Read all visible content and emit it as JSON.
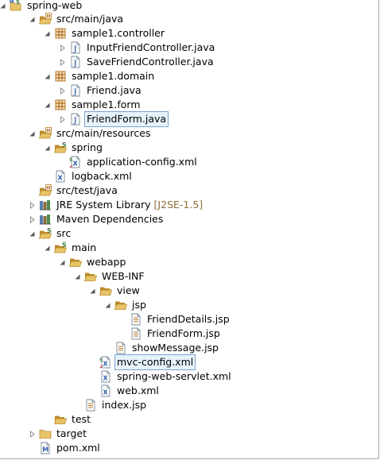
{
  "colors": {
    "folder": "#e8c468",
    "folder_dark": "#b98b2a",
    "package": "#b8792b",
    "java": "#5a7fb5",
    "selection_bg": "#e6f3fb",
    "selection_border": "#7da2ce",
    "decoration": "#8b6e34"
  },
  "tree": [
    {
      "label": "spring-web",
      "icon": "project-icon",
      "twisty": "expanded"
    },
    {
      "label": "src/main/java",
      "icon": "source-folder-icon",
      "twisty": "expanded"
    },
    {
      "label": "sample1.controller",
      "icon": "package-icon",
      "twisty": "expanded"
    },
    {
      "label": "InputFriendController.java",
      "icon": "java-file-icon",
      "twisty": "collapsed"
    },
    {
      "label": "SaveFriendController.java",
      "icon": "java-file-icon",
      "twisty": "collapsed"
    },
    {
      "label": "sample1.domain",
      "icon": "package-icon",
      "twisty": "expanded"
    },
    {
      "label": "Friend.java",
      "icon": "java-file-icon",
      "twisty": "collapsed"
    },
    {
      "label": "sample1.form",
      "icon": "package-icon",
      "twisty": "expanded"
    },
    {
      "label": "FriendForm.java",
      "icon": "java-file-icon",
      "twisty": "collapsed",
      "selected": true
    },
    {
      "label": "src/main/resources",
      "icon": "source-folder-icon",
      "twisty": "expanded"
    },
    {
      "label": "spring",
      "icon": "spring-folder-icon",
      "twisty": "expanded"
    },
    {
      "label": "application-config.xml",
      "icon": "spring-xml-icon",
      "twisty": "none"
    },
    {
      "label": "logback.xml",
      "icon": "xml-file-icon",
      "twisty": "none"
    },
    {
      "label": "src/test/java",
      "icon": "source-folder-icon",
      "twisty": "none"
    },
    {
      "label": "JRE System Library",
      "decoration": "[J2SE-1.5]",
      "icon": "library-icon",
      "twisty": "collapsed"
    },
    {
      "label": "Maven Dependencies",
      "icon": "library-icon",
      "twisty": "collapsed"
    },
    {
      "label": "src",
      "icon": "spring-folder-icon",
      "twisty": "expanded"
    },
    {
      "label": "main",
      "icon": "spring-folder-icon",
      "twisty": "expanded"
    },
    {
      "label": "webapp",
      "icon": "folder-open-icon",
      "twisty": "expanded"
    },
    {
      "label": "WEB-INF",
      "icon": "folder-open-icon",
      "twisty": "expanded"
    },
    {
      "label": "view",
      "icon": "folder-open-icon",
      "twisty": "expanded"
    },
    {
      "label": "jsp",
      "icon": "folder-open-icon",
      "twisty": "expanded"
    },
    {
      "label": "FriendDetails.jsp",
      "icon": "jsp-file-icon",
      "twisty": "none"
    },
    {
      "label": "FriendForm.jsp",
      "icon": "jsp-file-icon",
      "twisty": "none"
    },
    {
      "label": "showMessage.jsp",
      "icon": "jsp-file-icon",
      "twisty": "none"
    },
    {
      "label": "mvc-config.xml",
      "icon": "spring-xml-icon",
      "twisty": "none",
      "selected": true
    },
    {
      "label": "spring-web-servlet.xml",
      "icon": "xml-file-icon",
      "twisty": "none"
    },
    {
      "label": "web.xml",
      "icon": "xml-file-icon",
      "twisty": "none"
    },
    {
      "label": "index.jsp",
      "icon": "jsp-file-icon",
      "twisty": "none"
    },
    {
      "label": "test",
      "icon": "folder-open-icon",
      "twisty": "none"
    },
    {
      "label": "target",
      "icon": "folder-icon",
      "twisty": "collapsed"
    },
    {
      "label": "pom.xml",
      "icon": "maven-pom-icon",
      "twisty": "none"
    }
  ]
}
